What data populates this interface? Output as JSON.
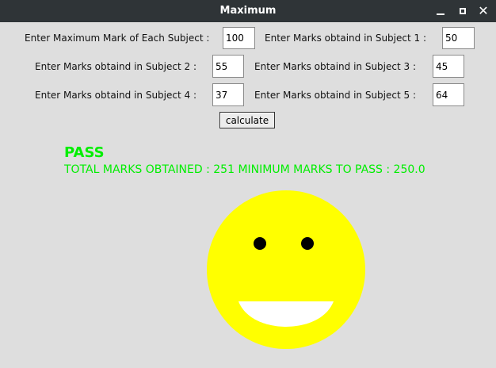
{
  "window": {
    "title": "Maximum",
    "minimize_icon": "minimize-icon",
    "maximize_icon": "maximize-icon",
    "close_icon": "close-icon",
    "close_glyph": "✕"
  },
  "form": {
    "max_mark_label": "Enter Maximum Mark of Each Subject :",
    "max_mark_value": "100",
    "subject1_label": "Enter Marks obtaind in Subject 1 :",
    "subject1_value": "50",
    "subject2_label": "Enter Marks obtaind in Subject 2 :",
    "subject2_value": "55",
    "subject3_label": "Enter Marks obtaind in Subject 3 :",
    "subject3_value": "45",
    "subject4_label": "Enter Marks obtaind in Subject 4 :",
    "subject4_value": "37",
    "subject5_label": "Enter Marks obtaind in Subject 5 :",
    "subject5_value": "64",
    "calculate_label": "calculate"
  },
  "result": {
    "status": "PASS",
    "totals_text": "TOTAL MARKS OBTAINED : 251  MINIMUM MARKS TO PASS : 250.0",
    "color": "#00ee00"
  },
  "face": {
    "expression": "smiley-face",
    "face_color": "#ffff00",
    "eye_color": "#000000",
    "mouth_color": "#ffffff"
  }
}
